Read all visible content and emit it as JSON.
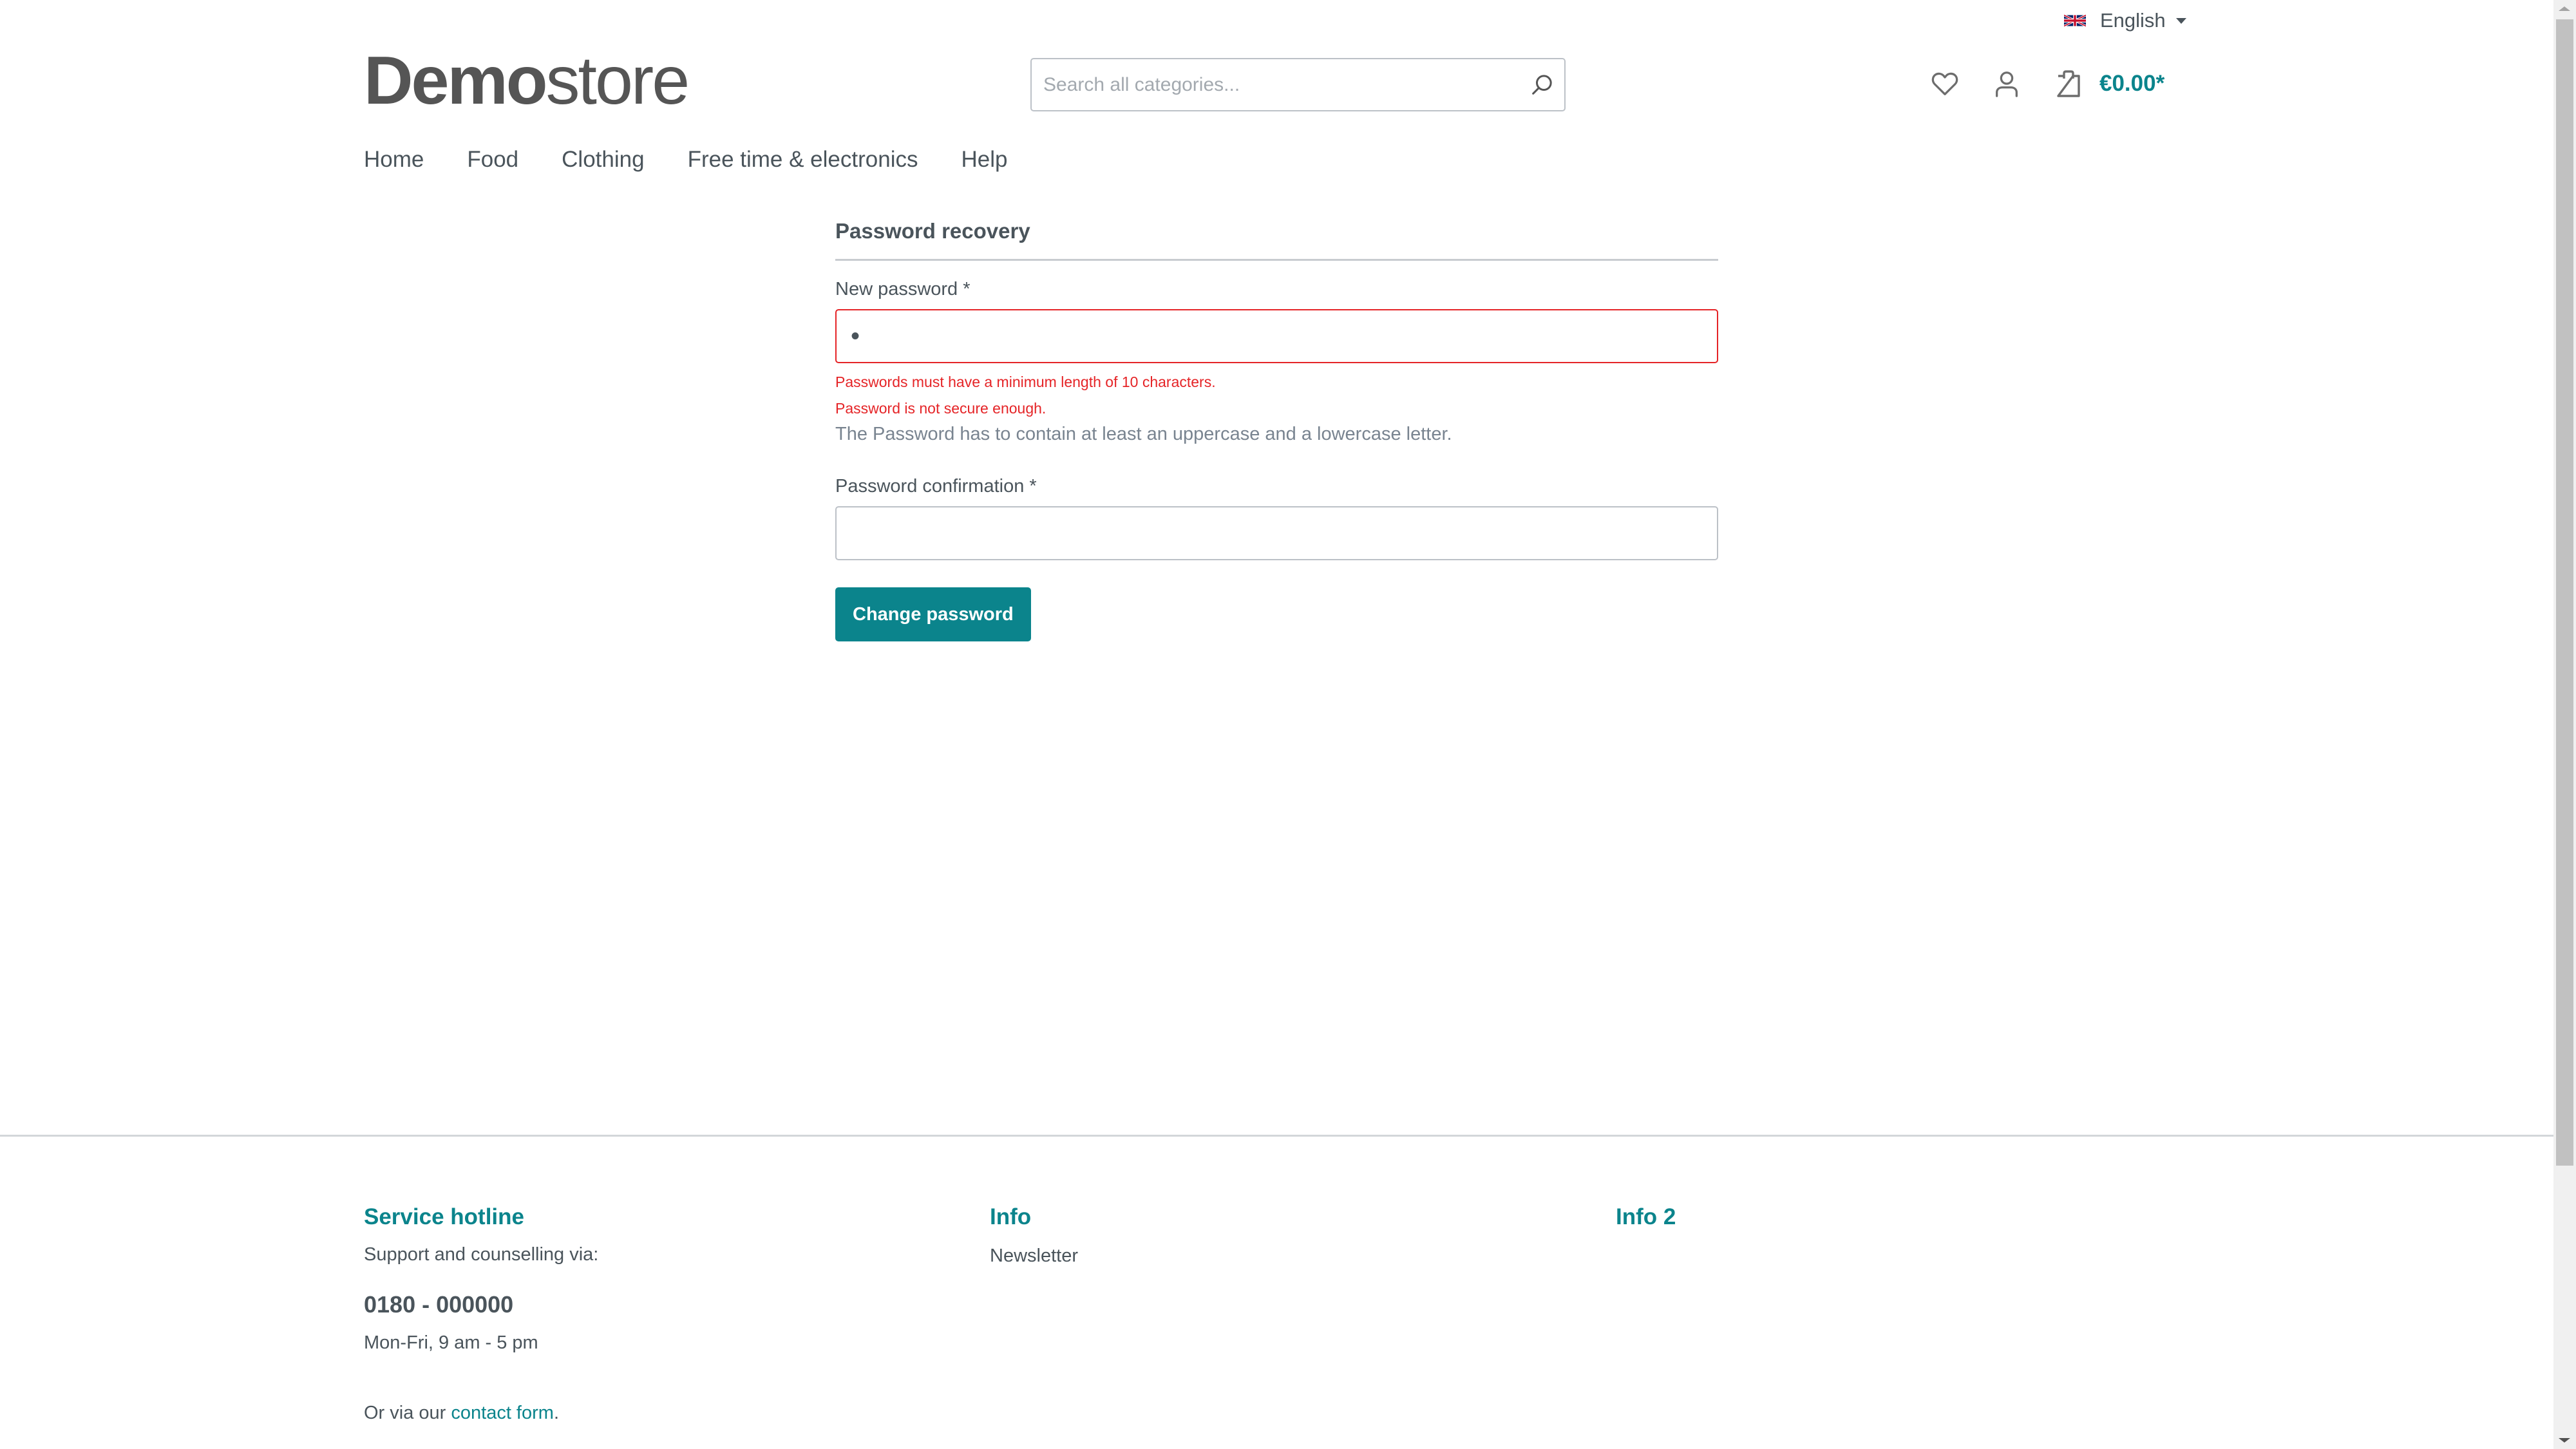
{
  "topbar": {
    "language": "English",
    "flag_icon": "uk-flag-icon"
  },
  "header": {
    "logo_bold": "Demo",
    "logo_light": "store",
    "search_placeholder": "Search all categories...",
    "search_value": "",
    "wishlist_icon": "heart-icon",
    "account_icon": "user-icon",
    "cart_icon": "shopping-bag-icon",
    "cart_total": "€0.00*"
  },
  "nav": {
    "items": [
      {
        "label": "Home"
      },
      {
        "label": "Food"
      },
      {
        "label": "Clothing"
      },
      {
        "label": "Free time & electronics"
      },
      {
        "label": "Help"
      }
    ]
  },
  "form": {
    "title": "Password recovery",
    "new_password_label": "New password *",
    "new_password_value": "•",
    "errors": [
      "Passwords must have a minimum length of 10 characters.",
      "Password is not secure enough."
    ],
    "hint": "The Password has to contain at least an uppercase and a lowercase letter.",
    "confirm_label": "Password confirmation *",
    "confirm_value": "",
    "submit_label": "Change password"
  },
  "footer": {
    "col1": {
      "title": "Service hotline",
      "intro": "Support and counselling via:",
      "phone": "0180 - 000000",
      "hours": "Mon-Fri, 9 am - 5 pm",
      "contact_prefix": "Or via our ",
      "contact_link": "contact form",
      "contact_suffix": "."
    },
    "col2": {
      "title": "Info",
      "links": [
        {
          "label": "Newsletter"
        }
      ]
    },
    "col3": {
      "title": "Info 2"
    }
  },
  "colors": {
    "accent": "#0b848c",
    "error": "#e52427",
    "text": "#4a545b",
    "muted": "#798490",
    "border": "#bcc1c7"
  }
}
